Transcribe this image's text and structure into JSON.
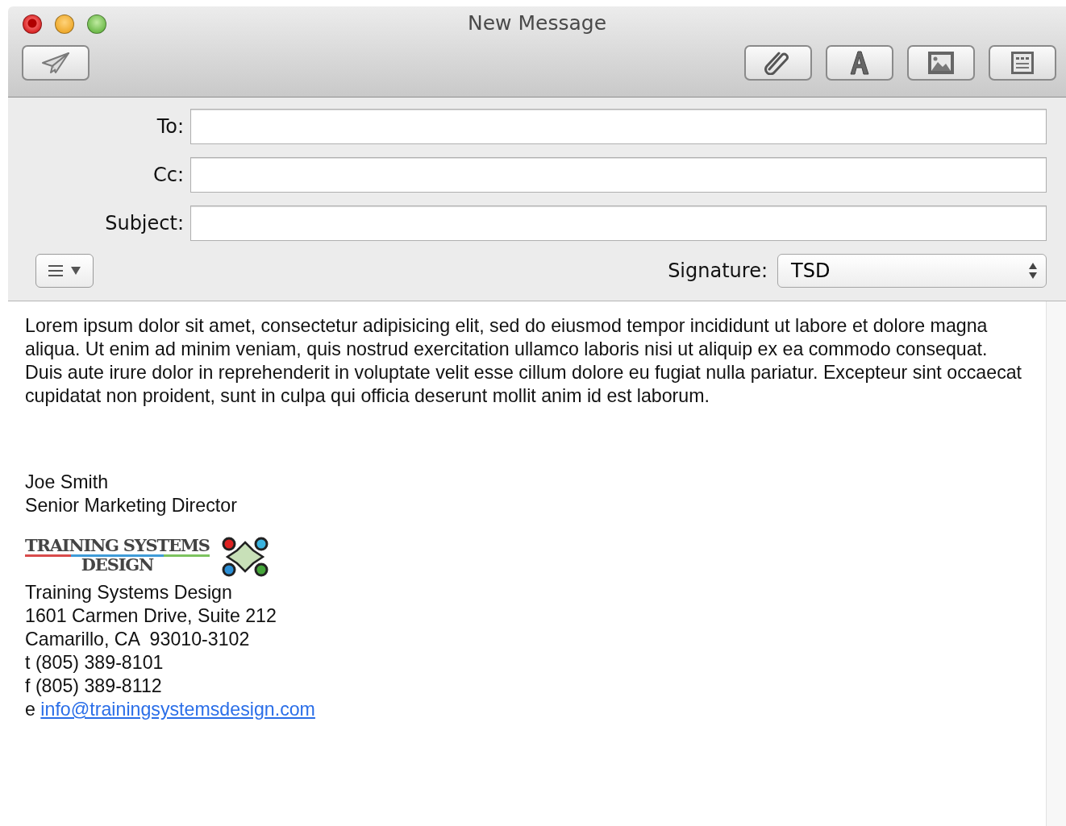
{
  "window": {
    "title": "New Message"
  },
  "header_fields": [
    {
      "label": "To:"
    },
    {
      "label": "Cc:"
    },
    {
      "label": "Subject:"
    }
  ],
  "signature": {
    "label": "Signature:",
    "value": "TSD"
  },
  "body": {
    "paragraph": "Lorem ipsum dolor sit amet, consectetur adipisicing elit, sed do eiusmod tempor incididunt ut labore et dolore magna aliqua. Ut enim ad minim veniam, quis nostrud exercitation ullamco laboris nisi ut aliquip ex ea commodo consequat. Duis aute irure dolor in reprehenderit in voluptate velit esse cillum dolore eu fugiat nulla pariatur. Excepteur sint occaecat cupidatat non proident, sunt in culpa qui officia deserunt mollit anim id est laborum.",
    "signature_lines": [
      "Joe Smith",
      "Senior Marketing Director"
    ],
    "logo": {
      "line_1": "TRAINING SYSTEMS",
      "line_2": "DESIGN"
    },
    "address_lines": [
      "Training Systems Design",
      "1601 Carmen Drive, Suite 212",
      "Camarillo, CA  93010-3102",
      "t (805) 389-8101",
      "f (805) 389-8112"
    ],
    "email": {
      "prefix": "e",
      "link": "info@trainingsystemsdesign.com"
    }
  }
}
